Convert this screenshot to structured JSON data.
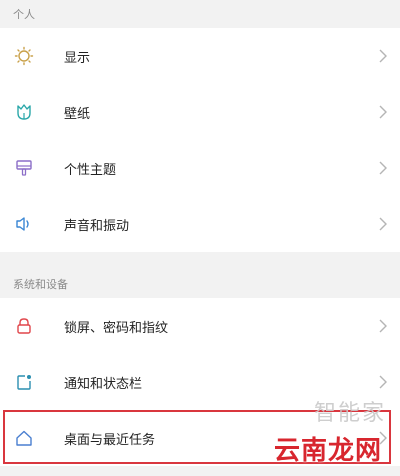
{
  "sections": [
    {
      "header": "个人",
      "items": [
        {
          "label": "显示",
          "icon": "sun-icon"
        },
        {
          "label": "壁纸",
          "icon": "tulip-icon"
        },
        {
          "label": "个性主题",
          "icon": "paint-brush-icon"
        },
        {
          "label": "声音和振动",
          "icon": "speaker-icon"
        }
      ]
    },
    {
      "header": "系统和设备",
      "items": [
        {
          "label": "锁屏、密码和指纹",
          "icon": "lock-icon"
        },
        {
          "label": "通知和状态栏",
          "icon": "notification-icon"
        },
        {
          "label": "桌面与最近任务",
          "icon": "home-icon"
        }
      ]
    }
  ],
  "watermark": {
    "text_top": "智能家",
    "text_bottom": "云南龙网"
  },
  "colors": {
    "icon_red": "#e0454a",
    "icon_teal": "#2aa7a9",
    "icon_gold": "#c9a14a",
    "icon_purple": "#8c6ec8",
    "icon_blue": "#3a86d4",
    "icon_home": "#4a7fd0",
    "highlight": "#d9363e"
  }
}
